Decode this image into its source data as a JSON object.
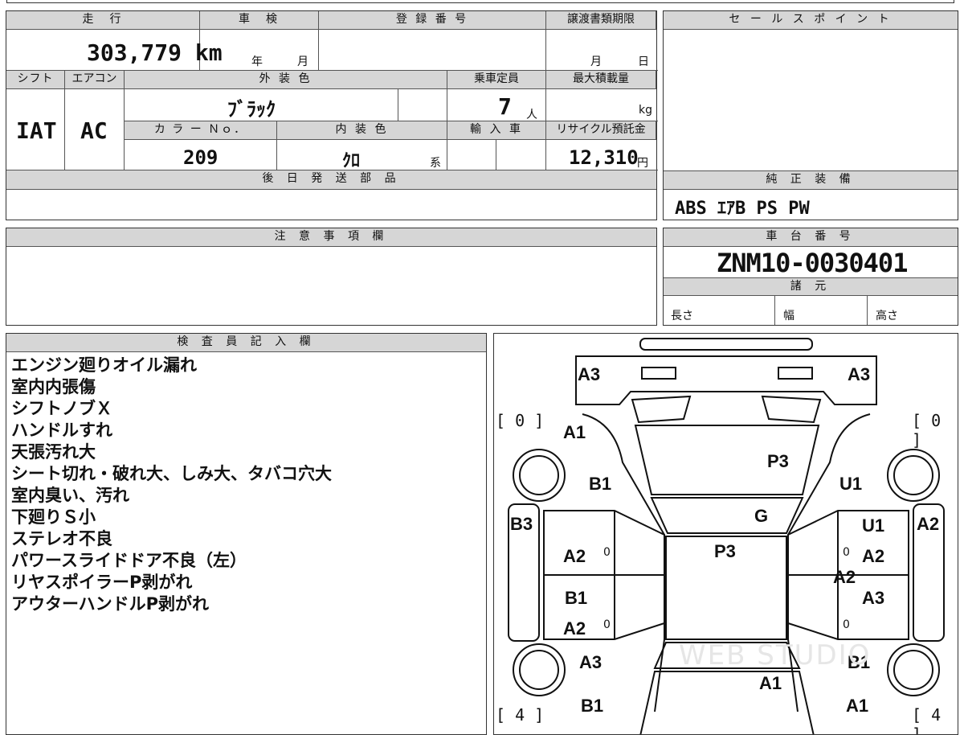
{
  "top": {
    "mileage_label": "走　行",
    "mileage_value": "303,779 km",
    "inspection_label": "車　検",
    "inspection_year": "年",
    "inspection_month": "月",
    "reg_label": "登 録 番 号",
    "transfer_label": "譲渡書類期限",
    "transfer_month": "月",
    "transfer_day": "日",
    "sales_point_label": "セ ー ル ス ポ イ ン ト"
  },
  "specs": {
    "shift_label": "シフト",
    "shift_value": "IAT",
    "ac_label": "エアコン",
    "ac_value": "AC",
    "exterior_label": "外 装 色",
    "exterior_value": "ﾌﾞﾗｯｸ",
    "capacity_label": "乗車定員",
    "capacity_value": "7",
    "capacity_unit": "人",
    "maxload_label": "最大積載量",
    "maxload_unit": "kg",
    "colorno_label": "カ ラ ー Ｎｏ．",
    "colorno_value": "209",
    "interior_label": "内 装 色",
    "interior_value": "ｸﾛ",
    "interior_unit": "系",
    "import_label": "輸 入 車",
    "recycle_label": "リサイクル預託金",
    "recycle_value": "12,310",
    "recycle_unit": "円"
  },
  "later_parts_label": "後 日 発 送 部 品",
  "equipment": {
    "label": "純 正 装 備",
    "value": "ABS ｴｱB PS PW"
  },
  "notes_label": "注 意 事 項 欄",
  "chassis": {
    "label": "車 台 番 号",
    "value": "ZNM10-0030401",
    "dims_label": "諸 元",
    "length": "長さ",
    "width": "幅",
    "height": "高さ"
  },
  "inspector": {
    "label": "検 査 員 記 入 欄",
    "remarks": [
      "エンジン廻りオイル漏れ",
      "室内内張傷",
      "シフトノブＸ",
      "ハンドルすれ",
      "天張汚れ大",
      "シート切れ・破れ大、しみ大、タバコ穴大",
      "室内臭い、汚れ",
      "下廻りＳ小",
      "ステレオ不良",
      "パワースライドドア不良（左）",
      "リヤスポイラーP剥がれ",
      "アウターハンドルP剥がれ"
    ]
  },
  "diagram": {
    "tire_fl": "[ 0 ]",
    "tire_fr": "[ 0 ]",
    "tire_rl": "[ 4 ]",
    "tire_rr": "[ 4 ]",
    "marks": {
      "a3_fl": "A3",
      "a3_fr": "A3",
      "a1_fl": "A1",
      "p3_hood": "P3",
      "b1_fender_l": "B1",
      "u1_fender_r": "U1",
      "g_glass": "G",
      "b3_side_l": "B3",
      "a2_side_r": "A2",
      "u1_door_r": "U1",
      "a2_door_l1": "A2",
      "p3_roof": "P3",
      "a2_door_r1": "A2",
      "a2_pillar_r": "A2",
      "b1_door_l": "B1",
      "a3_door_r": "A3",
      "a2_door_l2": "A2",
      "a3_quarter_l": "A3",
      "b1_quarter_r": "B1",
      "a1_trunk": "A1",
      "b1_rear_l": "B1",
      "a1_rear_r": "A1"
    },
    "zero_mark": "0",
    "watermark": "WEB STUDIO"
  }
}
